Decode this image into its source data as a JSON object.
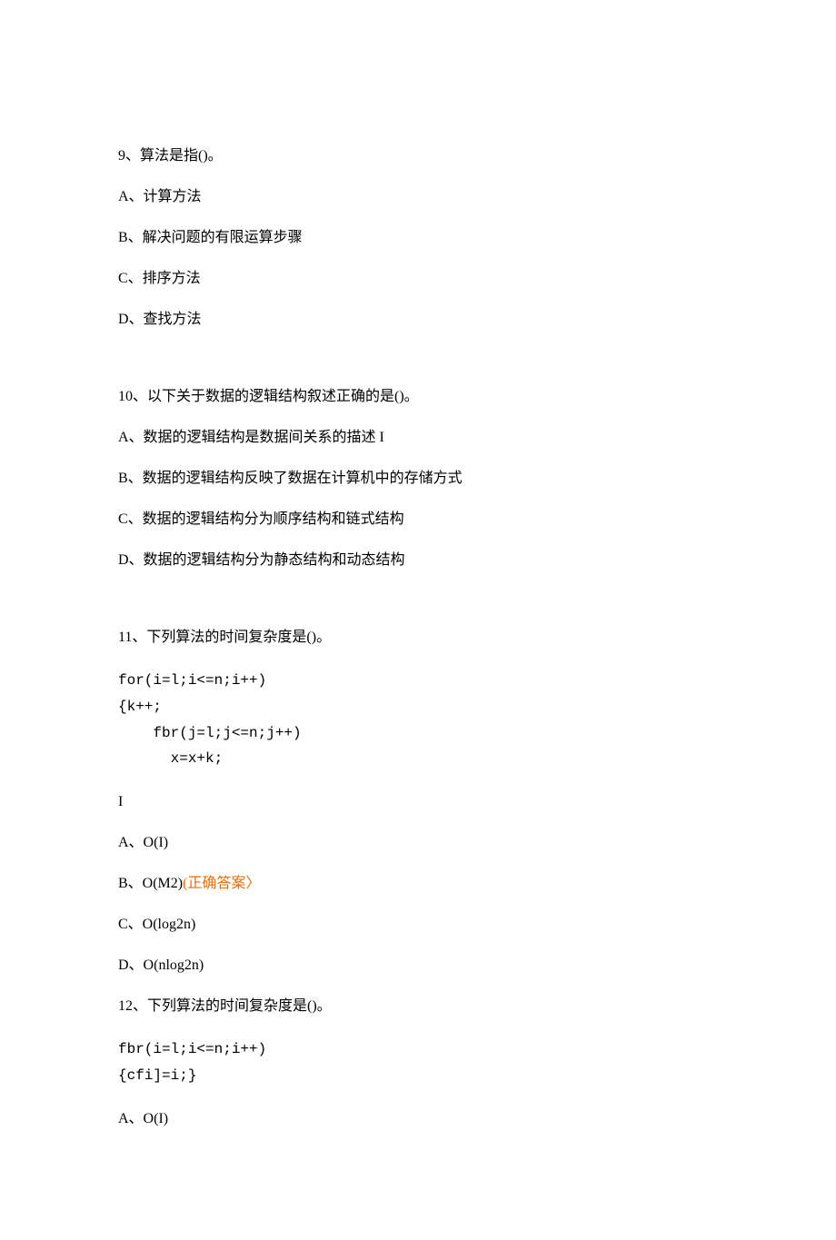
{
  "q9": {
    "stem": "9、算法是指()。",
    "a": "A、计算方法",
    "b": "B、解决问题的有限运算步骤",
    "c": "C、排序方法",
    "d": "D、查找方法"
  },
  "q10": {
    "stem": "10、以下关于数据的逻辑结构叙述正确的是()。",
    "a": "A、数据的逻辑结构是数据间关系的描述 I",
    "b": "B、数据的逻辑结构反映了数据在计算机中的存储方式",
    "c": "C、数据的逻辑结构分为顺序结构和链式结构",
    "d": "D、数据的逻辑结构分为静态结构和动态结构"
  },
  "q11": {
    "stem": "11、下列算法的时间复杂度是()。",
    "code": "for(i=l;i<=n;i++)\n{k++;\n    fbr(j=l;j<=n;j++)\n      x=x+k;",
    "post_code": "I",
    "a": "A、O(I)",
    "b_prefix": "B、O(M2)",
    "b_answer": "(正确答案〉",
    "c": "C、O(log2n)",
    "d": "D、O(nlog2n)"
  },
  "q12": {
    "stem": "12、下列算法的时间复杂度是()。",
    "code": "fbr(i=l;i<=n;i++)\n{cfi]=i;}",
    "a": "A、O(I)"
  }
}
